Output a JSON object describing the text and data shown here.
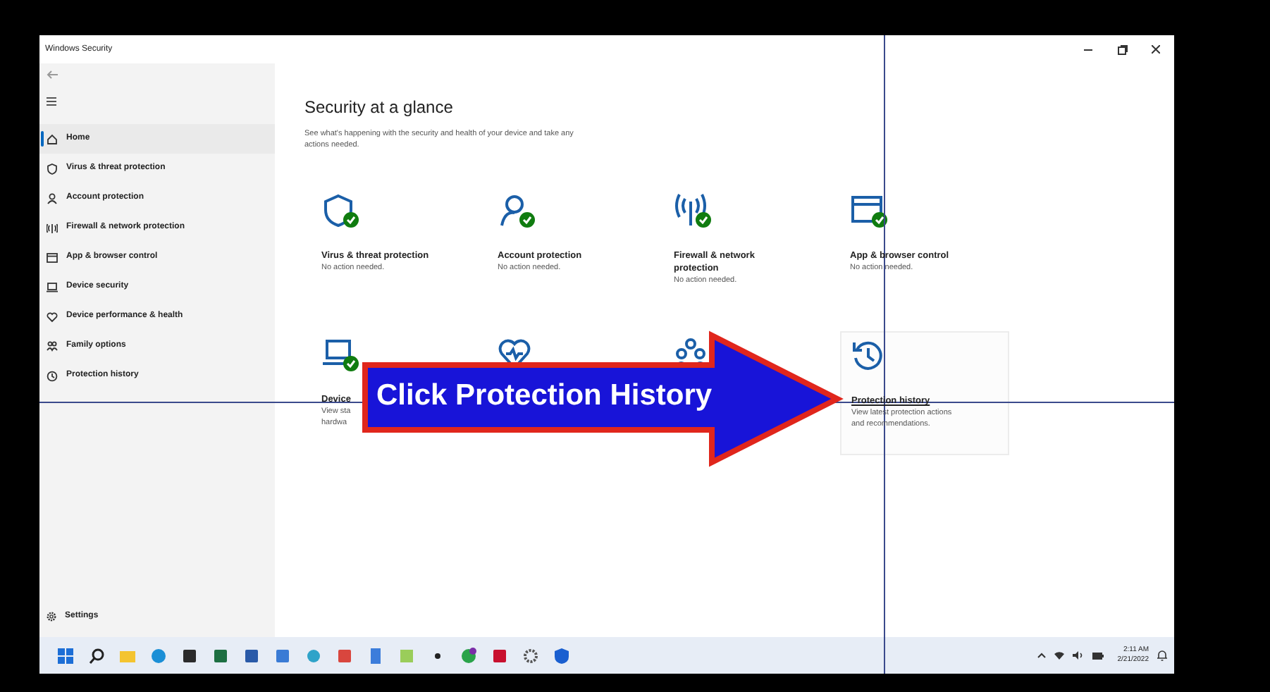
{
  "window": {
    "title": "Windows Security"
  },
  "sidebar": {
    "items": [
      {
        "label": "Home",
        "selected": true
      },
      {
        "label": "Virus & threat protection",
        "selected": false
      },
      {
        "label": "Account protection",
        "selected": false
      },
      {
        "label": "Firewall & network protection",
        "selected": false
      },
      {
        "label": "App & browser control",
        "selected": false
      },
      {
        "label": "Device security",
        "selected": false
      },
      {
        "label": "Device performance & health",
        "selected": false
      },
      {
        "label": "Family options",
        "selected": false
      },
      {
        "label": "Protection history",
        "selected": false
      }
    ],
    "settings": "Settings"
  },
  "content": {
    "heading": "Security at a glance",
    "subtitle": "See what's happening with the security and health of your device and take any actions needed.",
    "tiles": [
      {
        "title": [
          "Virus & threat protection"
        ],
        "description": [
          "No action needed."
        ],
        "badge": true,
        "hovered": false
      },
      {
        "title": [
          "Account protection"
        ],
        "description": [
          "No action needed."
        ],
        "badge": true,
        "hovered": false
      },
      {
        "title": [
          "Firewall & network",
          "protection"
        ],
        "description": [
          "No action needed."
        ],
        "badge": true,
        "hovered": false
      },
      {
        "title": [
          "App & browser control"
        ],
        "description": [
          "No action needed."
        ],
        "badge": true,
        "hovered": false
      },
      {
        "title": [
          "Device"
        ],
        "description": [
          "View sta",
          "hardwa"
        ],
        "badge": true,
        "hovered": false
      },
      {
        "badge": false,
        "hovered": false
      },
      {
        "badge": false,
        "hovered": false
      },
      {
        "title": [
          "Protection history"
        ],
        "description": [
          "View latest protection actions",
          "and recommendations."
        ],
        "badge": false,
        "hovered": true
      }
    ]
  },
  "callout": {
    "text": "Click Protection History"
  },
  "taskbar": {
    "time": "2:11 AM",
    "date": "2/21/2022"
  }
}
